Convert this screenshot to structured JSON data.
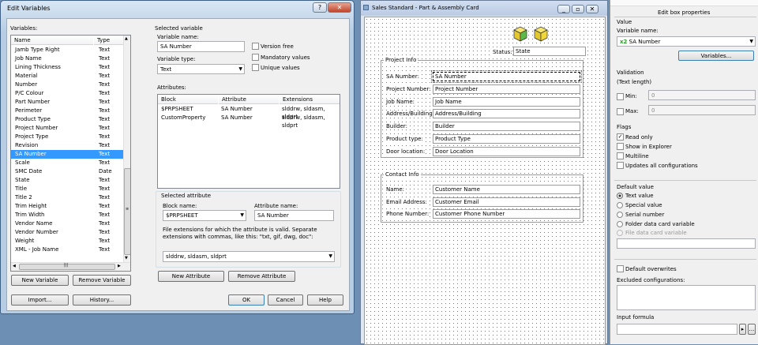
{
  "dialog": {
    "title": "Edit Variables",
    "variables_label": "Variables:",
    "columns": {
      "name": "Name",
      "type": "Type"
    },
    "variables": [
      {
        "name": "Jamb Type Right",
        "type": "Text"
      },
      {
        "name": "Job Name",
        "type": "Text"
      },
      {
        "name": "Lining Thickness",
        "type": "Text"
      },
      {
        "name": "Material",
        "type": "Text"
      },
      {
        "name": "Number",
        "type": "Text"
      },
      {
        "name": "P/C Colour",
        "type": "Text"
      },
      {
        "name": "Part Number",
        "type": "Text"
      },
      {
        "name": "Perimeter",
        "type": "Text"
      },
      {
        "name": "Product Type",
        "type": "Text"
      },
      {
        "name": "Project Number",
        "type": "Text"
      },
      {
        "name": "Project Type",
        "type": "Text"
      },
      {
        "name": "Revision",
        "type": "Text"
      },
      {
        "name": "SA Number",
        "type": "Text"
      },
      {
        "name": "Scale",
        "type": "Text"
      },
      {
        "name": "SMC Date",
        "type": "Date"
      },
      {
        "name": "State",
        "type": "Text"
      },
      {
        "name": "Title",
        "type": "Text"
      },
      {
        "name": "Title 2",
        "type": "Text"
      },
      {
        "name": "Trim Height",
        "type": "Text"
      },
      {
        "name": "Trim Width",
        "type": "Text"
      },
      {
        "name": "Vendor Name",
        "type": "Text"
      },
      {
        "name": "Vendor Number",
        "type": "Text"
      },
      {
        "name": "Weight",
        "type": "Text"
      },
      {
        "name": "XML - Job Name",
        "type": "Text"
      }
    ],
    "selected_index": 12,
    "new_variable": "New Variable",
    "remove_variable": "Remove Variable",
    "import": "Import...",
    "history": "History...",
    "selected_variable": {
      "heading": "Selected variable",
      "name_label": "Variable name:",
      "name_value": "SA Number",
      "type_label": "Variable type:",
      "type_value": "Text",
      "version_free": "Version free",
      "mandatory": "Mandatory values",
      "unique": "Unique values"
    },
    "attributes": {
      "label": "Attributes:",
      "columns": {
        "block": "Block",
        "attribute": "Attribute",
        "extensions": "Extensions"
      },
      "rows": [
        {
          "block": "$PRPSHEET",
          "attribute": "SA Number",
          "extensions": "slddrw, sldasm, sldprt"
        },
        {
          "block": "CustomProperty",
          "attribute": "SA Number",
          "extensions": "slddrw, sldasm, sldprt"
        }
      ]
    },
    "selected_attribute": {
      "heading": "Selected attribute",
      "block_label": "Block name:",
      "block_value": "$PRPSHEET",
      "attr_label": "Attribute name:",
      "attr_value": "SA Number",
      "ext_help": "File extensions for which the attribute is valid. Separate extensions with commas, like this: \"txt, gif, dwg, doc\":",
      "ext_value": "slddrw, sldasm, sldprt",
      "new_attribute": "New Attribute",
      "remove_attribute": "Remove Attribute"
    },
    "ok": "OK",
    "cancel": "Cancel",
    "help": "Help"
  },
  "card": {
    "title": "Sales Standard - Part & Assembly Card",
    "status_label": "Status:",
    "status_value": "State",
    "project_info": "Project Info",
    "fields": [
      {
        "label": "SA Number:",
        "value": "SA Number"
      },
      {
        "label": "Project Number:",
        "value": "Project Number"
      },
      {
        "label": "Job Name:",
        "value": "Job Name"
      },
      {
        "label": "Address/Building:",
        "value": "Address/Building"
      },
      {
        "label": "Builder:",
        "value": "Builder"
      },
      {
        "label": "Product type:",
        "value": "Product Type"
      },
      {
        "label": "Door location:",
        "value": "Door Location"
      }
    ],
    "contact_info": "Contact Info",
    "contact_fields": [
      {
        "label": "Name:",
        "value": "Customer Name"
      },
      {
        "label": "Email Address:",
        "value": "Customer Email"
      },
      {
        "label": "Phone Number:",
        "value": "Customer Phone Number"
      }
    ]
  },
  "props": {
    "header": "Edit box properties",
    "value": "Value",
    "var_name_label": "Variable name:",
    "var_prefix": "x2",
    "var_name": "SA Number",
    "variables_btn": "Variables...",
    "validation": "Validation",
    "text_length": "(Text length)",
    "min": "Min:",
    "min_val": "0",
    "max": "Max:",
    "max_val": "0",
    "flags": "Flags",
    "read_only": "Read only",
    "show_explorer": "Show in Explorer",
    "multiline": "Multiline",
    "updates_all": "Updates all configurations",
    "default_value": "Default value",
    "text_value": "Text value",
    "special_value": "Special value",
    "serial_number": "Serial number",
    "folder_var": "Folder data card variable",
    "file_var": "File data card variable",
    "default_overwrites": "Default overwrites",
    "excluded": "Excluded configurations:",
    "input_formula": "Input formula"
  }
}
